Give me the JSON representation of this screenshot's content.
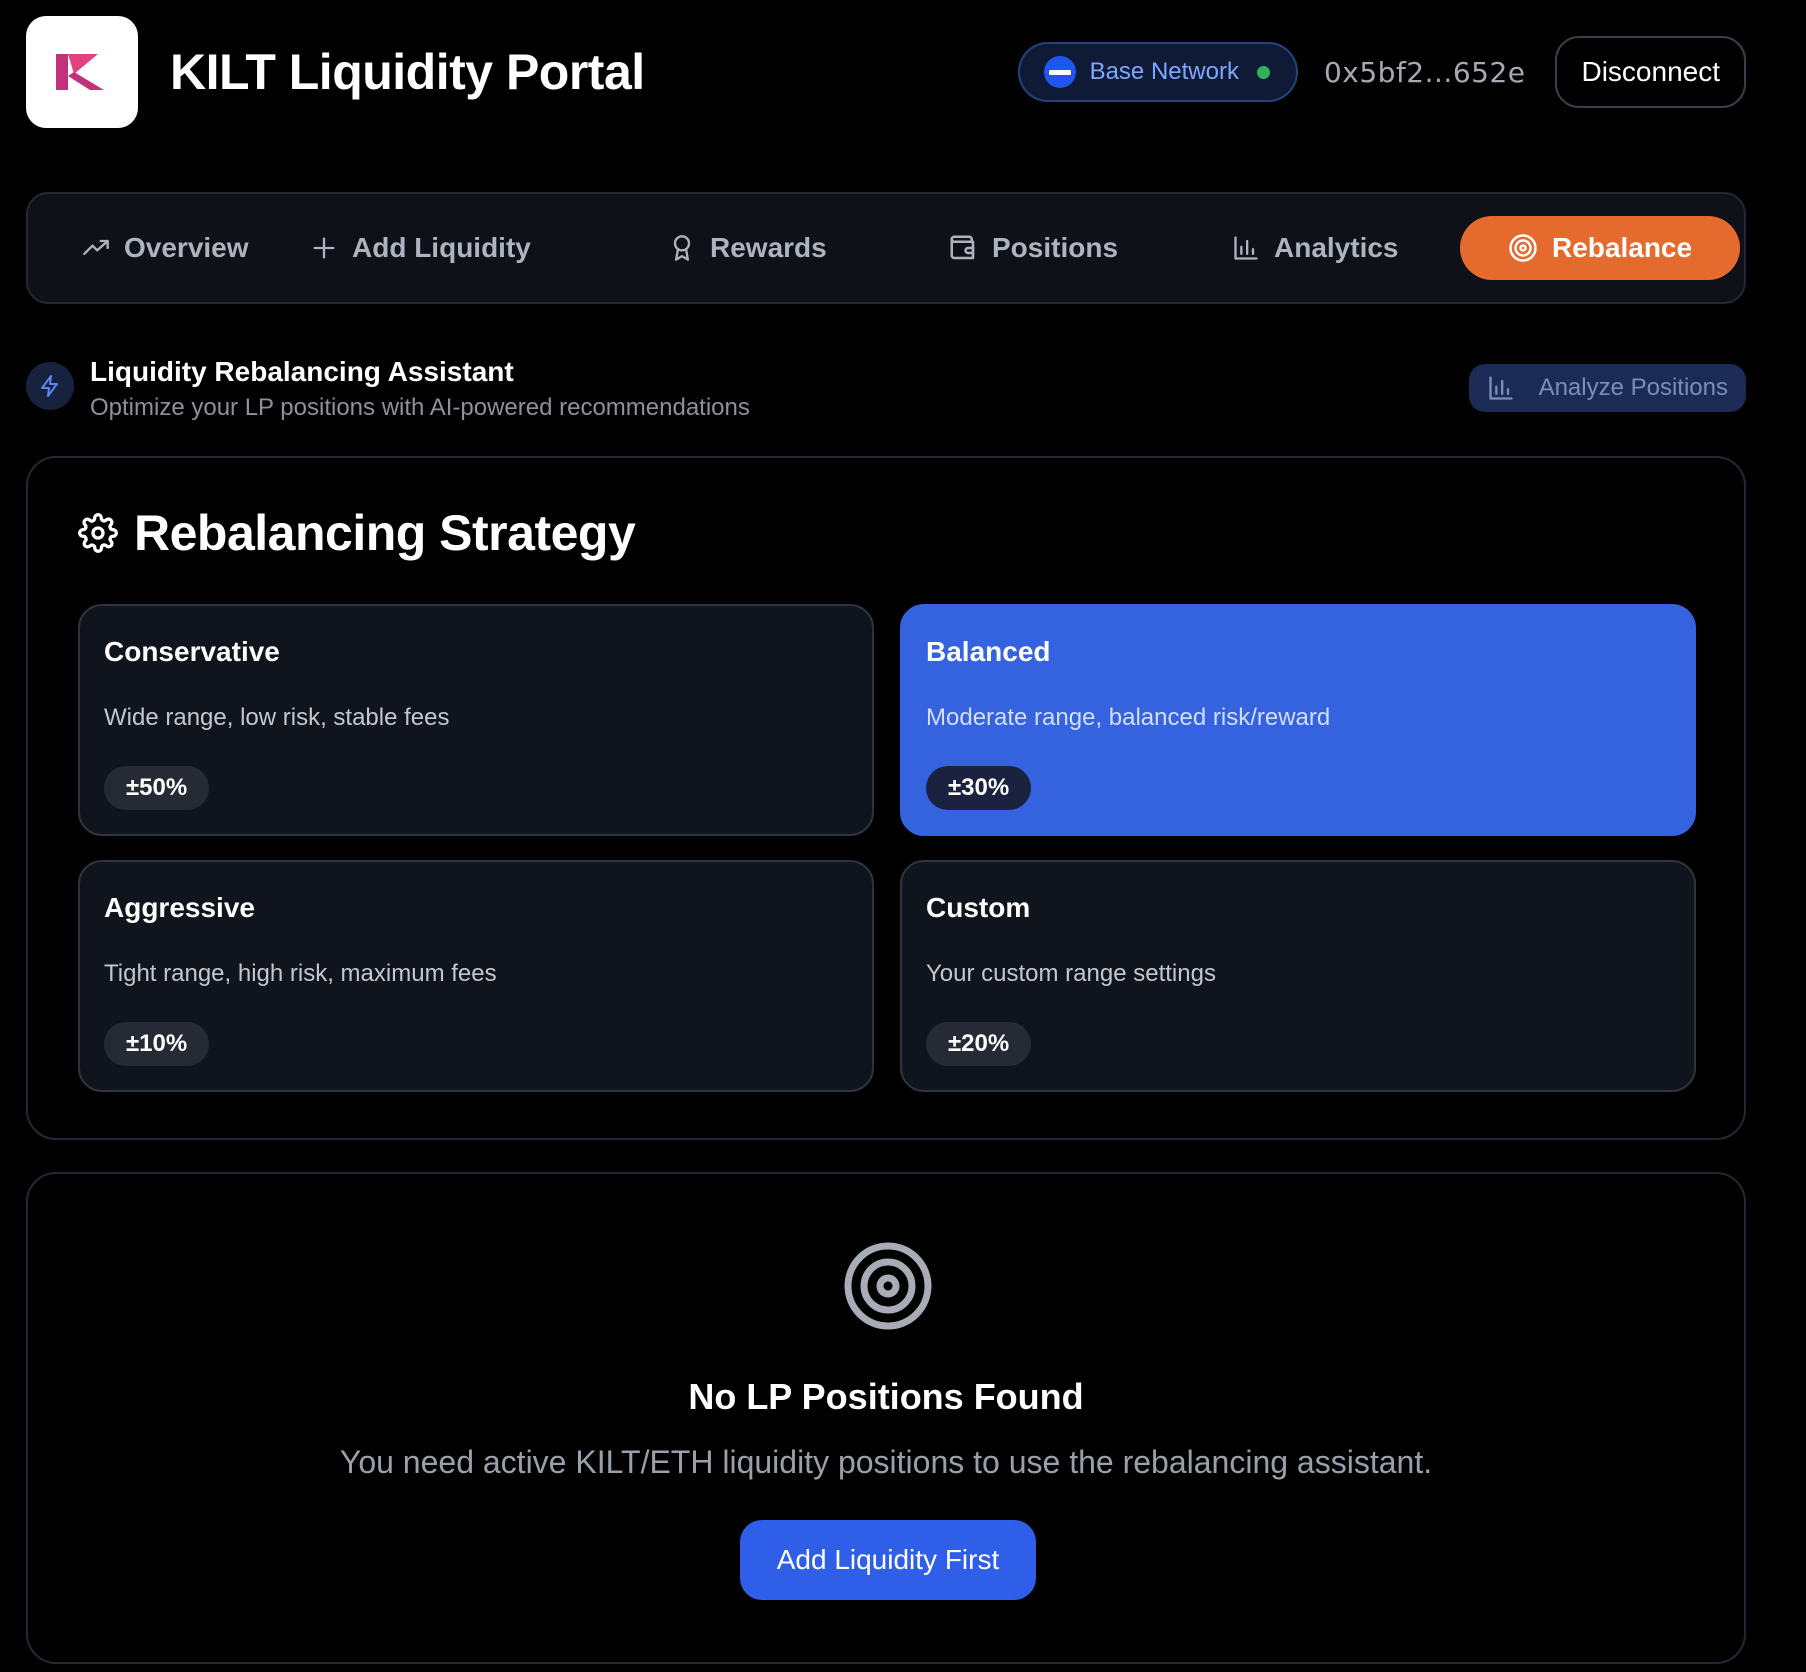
{
  "header": {
    "logo_icon": "kilt-logo-icon",
    "title": "KILT Liquidity Portal",
    "network": {
      "label": "Base Network",
      "icon": "base-network-icon",
      "status_color": "#2fb15d"
    },
    "wallet_address": "0x5bf2...652e",
    "disconnect_label": "Disconnect"
  },
  "nav": {
    "active_color": "#e56a2e",
    "tabs": [
      {
        "label": "Overview",
        "icon": "trending-up-icon",
        "active": false
      },
      {
        "label": "Add Liquidity",
        "icon": "plus-icon",
        "active": false
      },
      {
        "label": "Rewards",
        "icon": "award-icon",
        "active": false
      },
      {
        "label": "Positions",
        "icon": "wallet-icon",
        "active": false
      },
      {
        "label": "Analytics",
        "icon": "bar-chart-icon",
        "active": false
      },
      {
        "label": "Rebalance",
        "icon": "target-icon",
        "active": true
      }
    ]
  },
  "assistant": {
    "icon": "lightning-icon",
    "title": "Liquidity Rebalancing Assistant",
    "subtitle": "Optimize your LP positions with AI-powered recommendations",
    "analyze_label": "Analyze Positions"
  },
  "strategy": {
    "icon": "gear-icon",
    "title": "Rebalancing Strategy",
    "selected_color": "#3563e0",
    "options": [
      {
        "title": "Conservative",
        "description": "Wide range, low risk, stable fees",
        "range": "±50%",
        "selected": false
      },
      {
        "title": "Balanced",
        "description": "Moderate range, balanced risk/reward",
        "range": "±30%",
        "selected": true
      },
      {
        "title": "Aggressive",
        "description": "Tight range, high risk, maximum fees",
        "range": "±10%",
        "selected": false
      },
      {
        "title": "Custom",
        "description": "Your custom range settings",
        "range": "±20%",
        "selected": false
      }
    ]
  },
  "empty_state": {
    "icon": "target-icon",
    "title": "No LP Positions Found",
    "description": "You need active KILT/ETH liquidity positions to use the rebalancing assistant.",
    "button_label": "Add Liquidity First"
  }
}
